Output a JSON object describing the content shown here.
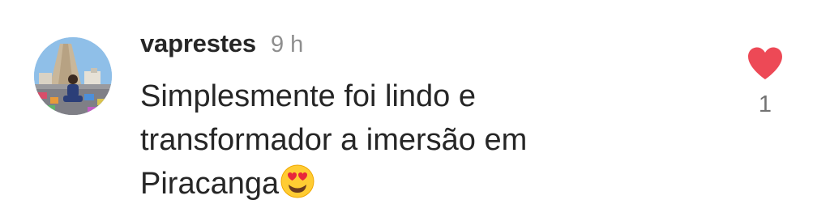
{
  "comment": {
    "username": "vaprestes",
    "timestamp": "9 h",
    "text_lines": [
      "Simplesmente foi lindo e",
      "transformador a imersão em",
      "Piracanga"
    ],
    "emoji": "heart-eyes-emoji",
    "like_count": "1",
    "icons": {
      "like": "heart-icon"
    },
    "colors": {
      "heart": "#ed4956",
      "text": "#262626",
      "muted": "#8e8e8e"
    }
  }
}
